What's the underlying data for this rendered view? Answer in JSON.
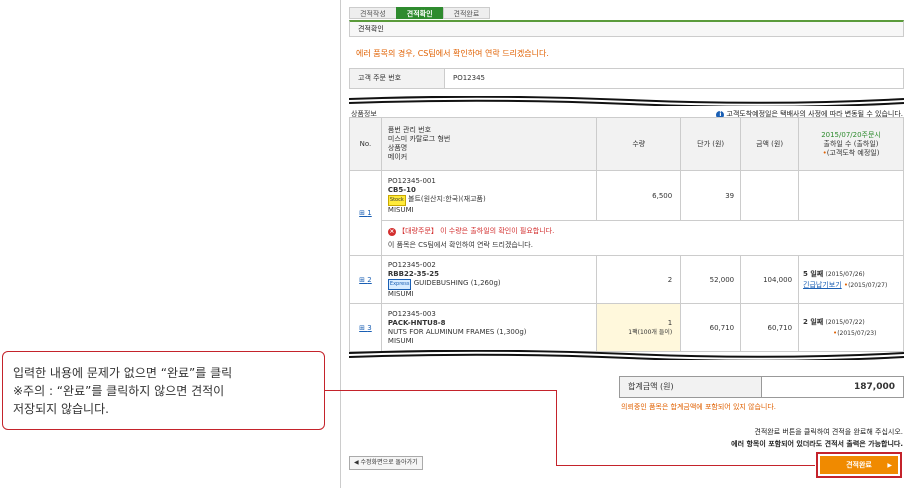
{
  "steps": [
    "견적작성",
    "견적확인",
    "견적완료"
  ],
  "title": "견적확인",
  "warning_top": "에러 품목의 경우, CS팀에서 확인하여 연락 드리겠습니다.",
  "order": {
    "label": "고객 주문 번호",
    "value": "PO12345"
  },
  "section_label": "상품정보",
  "info_note": "고객도착예정일은 택배사의 사정에 따라 변동될 수 있습니다.",
  "headers": {
    "no": "No.",
    "product_lines": [
      "품번 관리 번호",
      "미스미 카탈로그 형번",
      "상품명",
      "메이커"
    ],
    "qty": "수량",
    "unit_price": "단가 (원)",
    "amount": "금액 (원)",
    "ship_date": "2015/07/20주문시",
    "ship_days": "출하일 수 (출하일)",
    "delivery": "(고객도착 예정일)"
  },
  "rows": [
    {
      "no": "1",
      "code": "PO12345-001",
      "model": "CB5-10",
      "badge": "Stock",
      "name": "볼트(원산지:한국)(재고품)",
      "maker": "MISUMI",
      "qty": "6,500",
      "unit_price": "39",
      "amount": "",
      "error": "【대량주문】 이 수량은 출하일의 확인이 필요합니다.",
      "error_note": "이 품목은 CS팀에서 확인하여 연락 드리겠습니다."
    },
    {
      "no": "2",
      "code": "PO12345-002",
      "model": "RBB22-35-25",
      "badge": "Express",
      "name": "GUIDEBUSHING (1,260g)",
      "maker": "MISUMI",
      "qty": "2",
      "unit_price": "52,000",
      "amount": "104,000",
      "ship_days": "5 일째",
      "ship_date": "(2015/07/26)",
      "ship_link": "긴급납기보기",
      "delivery": "(2015/07/27)"
    },
    {
      "no": "3",
      "code": "PO12345-003",
      "model": "PACK-HNTU8-8",
      "name": "NUTS FOR ALUMINUM FRAMES (1,300g)",
      "maker": "MISUMI",
      "qty": "1",
      "qty_note": "1팩(100개 들이)",
      "unit_price": "60,710",
      "amount": "60,710",
      "ship_days": "2 일째",
      "ship_date": "(2015/07/22)",
      "delivery": "(2015/07/23)"
    }
  ],
  "total": {
    "label": "합계금액 (원)",
    "value": "187,000"
  },
  "total_note": "의뢰중인 품목은 합계금액에 포함되어 있지 않습니다.",
  "bottom_note": [
    "견적완료 버튼을 클릭하여 견적을 완료해 주십시오.",
    "에러 항목이 포함되어 있더라도 견적서 출력은 가능합니다."
  ],
  "back_button": "◀ 수정화면으로 돌아가기",
  "complete_button": "견적완료",
  "callout": [
    "입력한 내용에 문제가 없으면 “완료”를 클릭",
    "※주의 : “완료”를 클릭하지 않으면 견적이",
    "저장되지 않습니다."
  ],
  "colors": {
    "accent": "#2e8b2e",
    "warning": "#e06000",
    "error": "#d32f2f",
    "button": "#f08a00",
    "callout_border": "#c4232b"
  }
}
